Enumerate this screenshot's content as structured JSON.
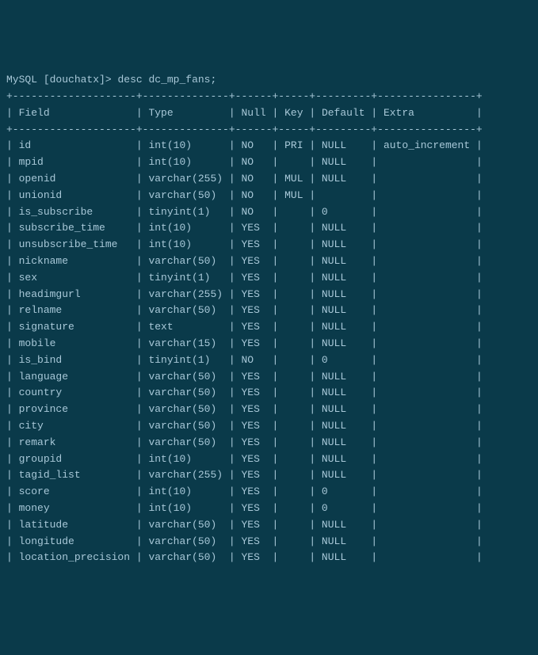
{
  "prompt": {
    "shell": "MySQL",
    "database": "[douchatx]>",
    "command": "desc dc_mp_fans;"
  },
  "headers": {
    "field": "Field",
    "type": "Type",
    "null": "Null",
    "key": "Key",
    "default": "Default",
    "extra": "Extra"
  },
  "rows": [
    {
      "field": "id",
      "type": "int(10)",
      "null": "NO",
      "key": "PRI",
      "default": "NULL",
      "extra": "auto_increment"
    },
    {
      "field": "mpid",
      "type": "int(10)",
      "null": "NO",
      "key": "",
      "default": "NULL",
      "extra": ""
    },
    {
      "field": "openid",
      "type": "varchar(255)",
      "null": "NO",
      "key": "MUL",
      "default": "NULL",
      "extra": ""
    },
    {
      "field": "unionid",
      "type": "varchar(50)",
      "null": "NO",
      "key": "MUL",
      "default": "",
      "extra": ""
    },
    {
      "field": "is_subscribe",
      "type": "tinyint(1)",
      "null": "NO",
      "key": "",
      "default": "0",
      "extra": ""
    },
    {
      "field": "subscribe_time",
      "type": "int(10)",
      "null": "YES",
      "key": "",
      "default": "NULL",
      "extra": ""
    },
    {
      "field": "unsubscribe_time",
      "type": "int(10)",
      "null": "YES",
      "key": "",
      "default": "NULL",
      "extra": ""
    },
    {
      "field": "nickname",
      "type": "varchar(50)",
      "null": "YES",
      "key": "",
      "default": "NULL",
      "extra": ""
    },
    {
      "field": "sex",
      "type": "tinyint(1)",
      "null": "YES",
      "key": "",
      "default": "NULL",
      "extra": ""
    },
    {
      "field": "headimgurl",
      "type": "varchar(255)",
      "null": "YES",
      "key": "",
      "default": "NULL",
      "extra": ""
    },
    {
      "field": "relname",
      "type": "varchar(50)",
      "null": "YES",
      "key": "",
      "default": "NULL",
      "extra": ""
    },
    {
      "field": "signature",
      "type": "text",
      "null": "YES",
      "key": "",
      "default": "NULL",
      "extra": ""
    },
    {
      "field": "mobile",
      "type": "varchar(15)",
      "null": "YES",
      "key": "",
      "default": "NULL",
      "extra": ""
    },
    {
      "field": "is_bind",
      "type": "tinyint(1)",
      "null": "NO",
      "key": "",
      "default": "0",
      "extra": ""
    },
    {
      "field": "language",
      "type": "varchar(50)",
      "null": "YES",
      "key": "",
      "default": "NULL",
      "extra": ""
    },
    {
      "field": "country",
      "type": "varchar(50)",
      "null": "YES",
      "key": "",
      "default": "NULL",
      "extra": ""
    },
    {
      "field": "province",
      "type": "varchar(50)",
      "null": "YES",
      "key": "",
      "default": "NULL",
      "extra": ""
    },
    {
      "field": "city",
      "type": "varchar(50)",
      "null": "YES",
      "key": "",
      "default": "NULL",
      "extra": ""
    },
    {
      "field": "remark",
      "type": "varchar(50)",
      "null": "YES",
      "key": "",
      "default": "NULL",
      "extra": ""
    },
    {
      "field": "groupid",
      "type": "int(10)",
      "null": "YES",
      "key": "",
      "default": "NULL",
      "extra": ""
    },
    {
      "field": "tagid_list",
      "type": "varchar(255)",
      "null": "YES",
      "key": "",
      "default": "NULL",
      "extra": ""
    },
    {
      "field": "score",
      "type": "int(10)",
      "null": "YES",
      "key": "",
      "default": "0",
      "extra": ""
    },
    {
      "field": "money",
      "type": "int(10)",
      "null": "YES",
      "key": "",
      "default": "0",
      "extra": ""
    },
    {
      "field": "latitude",
      "type": "varchar(50)",
      "null": "YES",
      "key": "",
      "default": "NULL",
      "extra": ""
    },
    {
      "field": "longitude",
      "type": "varchar(50)",
      "null": "YES",
      "key": "",
      "default": "NULL",
      "extra": ""
    },
    {
      "field": "location_precision",
      "type": "varchar(50)",
      "null": "YES",
      "key": "",
      "default": "NULL",
      "extra": ""
    }
  ],
  "chart_data": {
    "type": "table",
    "title": "desc dc_mp_fans",
    "columns": [
      "Field",
      "Type",
      "Null",
      "Key",
      "Default",
      "Extra"
    ],
    "data": [
      [
        "id",
        "int(10)",
        "NO",
        "PRI",
        "NULL",
        "auto_increment"
      ],
      [
        "mpid",
        "int(10)",
        "NO",
        "",
        "NULL",
        ""
      ],
      [
        "openid",
        "varchar(255)",
        "NO",
        "MUL",
        "NULL",
        ""
      ],
      [
        "unionid",
        "varchar(50)",
        "NO",
        "MUL",
        "",
        ""
      ],
      [
        "is_subscribe",
        "tinyint(1)",
        "NO",
        "",
        "0",
        ""
      ],
      [
        "subscribe_time",
        "int(10)",
        "YES",
        "",
        "NULL",
        ""
      ],
      [
        "unsubscribe_time",
        "int(10)",
        "YES",
        "",
        "NULL",
        ""
      ],
      [
        "nickname",
        "varchar(50)",
        "YES",
        "",
        "NULL",
        ""
      ],
      [
        "sex",
        "tinyint(1)",
        "YES",
        "",
        "NULL",
        ""
      ],
      [
        "headimgurl",
        "varchar(255)",
        "YES",
        "",
        "NULL",
        ""
      ],
      [
        "relname",
        "varchar(50)",
        "YES",
        "",
        "NULL",
        ""
      ],
      [
        "signature",
        "text",
        "YES",
        "",
        "NULL",
        ""
      ],
      [
        "mobile",
        "varchar(15)",
        "YES",
        "",
        "NULL",
        ""
      ],
      [
        "is_bind",
        "tinyint(1)",
        "NO",
        "",
        "0",
        ""
      ],
      [
        "language",
        "varchar(50)",
        "YES",
        "",
        "NULL",
        ""
      ],
      [
        "country",
        "varchar(50)",
        "YES",
        "",
        "NULL",
        ""
      ],
      [
        "province",
        "varchar(50)",
        "YES",
        "",
        "NULL",
        ""
      ],
      [
        "city",
        "varchar(50)",
        "YES",
        "",
        "NULL",
        ""
      ],
      [
        "remark",
        "varchar(50)",
        "YES",
        "",
        "NULL",
        ""
      ],
      [
        "groupid",
        "int(10)",
        "YES",
        "",
        "NULL",
        ""
      ],
      [
        "tagid_list",
        "varchar(255)",
        "YES",
        "",
        "NULL",
        ""
      ],
      [
        "score",
        "int(10)",
        "YES",
        "",
        "0",
        ""
      ],
      [
        "money",
        "int(10)",
        "YES",
        "",
        "0",
        ""
      ],
      [
        "latitude",
        "varchar(50)",
        "YES",
        "",
        "NULL",
        ""
      ],
      [
        "longitude",
        "varchar(50)",
        "YES",
        "",
        "NULL",
        ""
      ],
      [
        "location_precision",
        "varchar(50)",
        "YES",
        "",
        "NULL",
        ""
      ]
    ]
  }
}
